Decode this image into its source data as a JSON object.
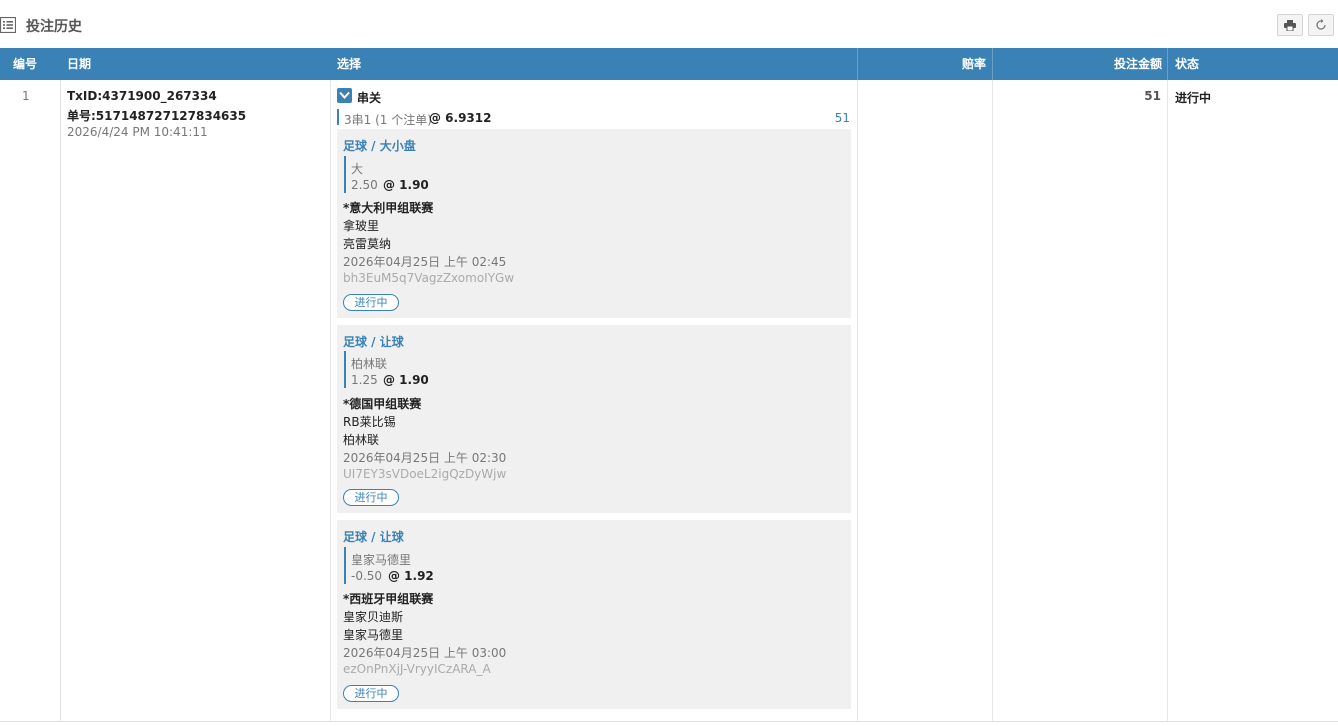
{
  "header": {
    "title": "投注历史"
  },
  "table": {
    "columns": {
      "num": "编号",
      "date": "日期",
      "selection": "选择",
      "odds": "赔率",
      "amount": "投注金额",
      "status": "状态"
    },
    "row": {
      "num": "1",
      "txid": "TxID:4371900_267334",
      "order": "单号:517148727127834635",
      "datetime": "2026/4/24 PM 10:41:11",
      "bet_type": "串关",
      "combo_desc": "3串1 (1 个注单)",
      "combo_odds": "@ 6.9312",
      "combo_stake": "51",
      "amount": "51",
      "status": "进行中",
      "legs": [
        {
          "sport_market": "足球 / 大小盘",
          "selection": "大",
          "line": "2.50",
          "odds": "@ 1.90",
          "league": "*意大利甲组联赛",
          "home": "拿玻里",
          "away": "亮雷莫纳",
          "time": "2026年04月25日 上午 02:45",
          "code": "bh3EuM5q7VagzZxomoIYGw",
          "status": "进行中"
        },
        {
          "sport_market": "足球 / 让球",
          "selection": "柏林联",
          "line": "1.25",
          "odds": "@ 1.90",
          "league": "*德国甲组联赛",
          "home": "RB莱比锡",
          "away": "柏林联",
          "time": "2026年04月25日 上午 02:30",
          "code": "UI7EY3sVDoeL2igQzDyWjw",
          "status": "进行中"
        },
        {
          "sport_market": "足球 / 让球",
          "selection": "皇家马德里",
          "line": "-0.50",
          "odds": "@ 1.92",
          "league": "*西班牙甲组联赛",
          "home": "皇家贝迪斯",
          "away": "皇家马德里",
          "time": "2026年04月25日 上午 03:00",
          "code": "ezOnPnXjJ-VryyICzARA_A",
          "status": "进行中"
        }
      ]
    }
  },
  "icons": {
    "title": "list-icon",
    "print": "print-icon",
    "refresh": "refresh-icon",
    "toggle": "chevron-down-icon"
  },
  "colors": {
    "header_bg": "#3a82b6",
    "accent": "#3a82b6",
    "leg_bg": "#f0f0f0"
  }
}
